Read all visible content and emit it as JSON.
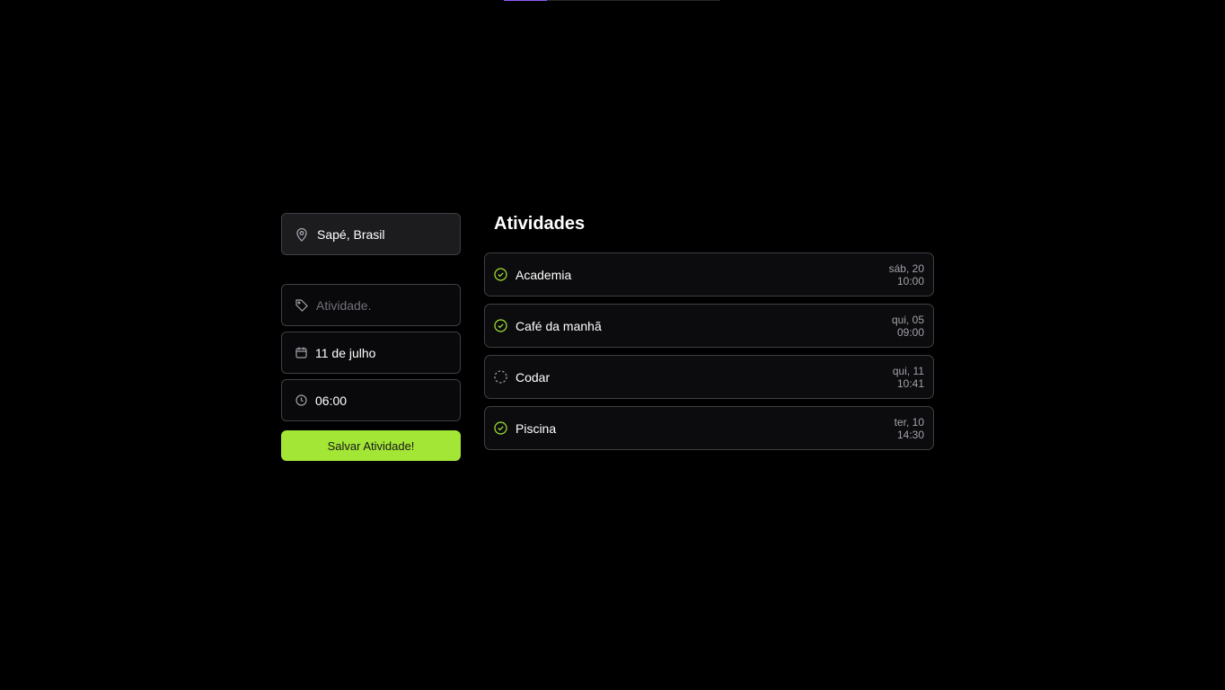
{
  "progress": {
    "fraction": 0.2,
    "track_color": "#27272a",
    "fill_color": "#8b5cf6"
  },
  "location": {
    "icon": "map-pin-icon",
    "text": "Sapé, Brasil"
  },
  "form": {
    "activity": {
      "icon": "tag-icon",
      "value": "",
      "placeholder": "Atividade."
    },
    "date": {
      "icon": "calendar-icon",
      "value": "11 de julho"
    },
    "time": {
      "icon": "clock-icon",
      "value": "06:00"
    },
    "save_label": "Salvar Atividade!"
  },
  "activities": {
    "title": "Atividades",
    "items": [
      {
        "name": "Academia",
        "day": "sáb, 20",
        "time": "10:00",
        "status": "done",
        "status_icon": "check-circle-icon"
      },
      {
        "name": "Café da manhã",
        "day": "qui, 05",
        "time": "09:00",
        "status": "done",
        "status_icon": "check-circle-icon"
      },
      {
        "name": "Codar",
        "day": "qui, 11",
        "time": "10:41",
        "status": "pending",
        "status_icon": "dashed-circle-icon"
      },
      {
        "name": "Piscina",
        "day": "ter, 10",
        "time": "14:30",
        "status": "done",
        "status_icon": "check-circle-icon"
      }
    ]
  },
  "colors": {
    "accent": "#a3e635",
    "background": "#000000"
  }
}
